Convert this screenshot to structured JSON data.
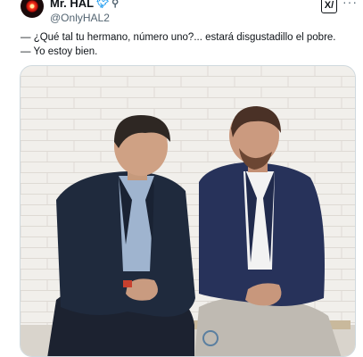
{
  "author": {
    "name": "Mr. HAL",
    "handle": "@OnlyHAL2",
    "avatar_icon": "hal-eye-icon",
    "verified_icon": "twitter-bird-icon",
    "extra_icon": "gender-symbol-icon"
  },
  "actions": {
    "grok_label": "X/",
    "more_label": "···"
  },
  "tweet": {
    "lines": [
      "— ¿Qué tal tu hermano, número uno?... estará disgustadillo el pobre.",
      "— Yo estoy bien."
    ]
  },
  "colors": {
    "accent": "#1d9bf0",
    "text": "#0f1419",
    "muted": "#536471",
    "border": "#cfd9de"
  }
}
